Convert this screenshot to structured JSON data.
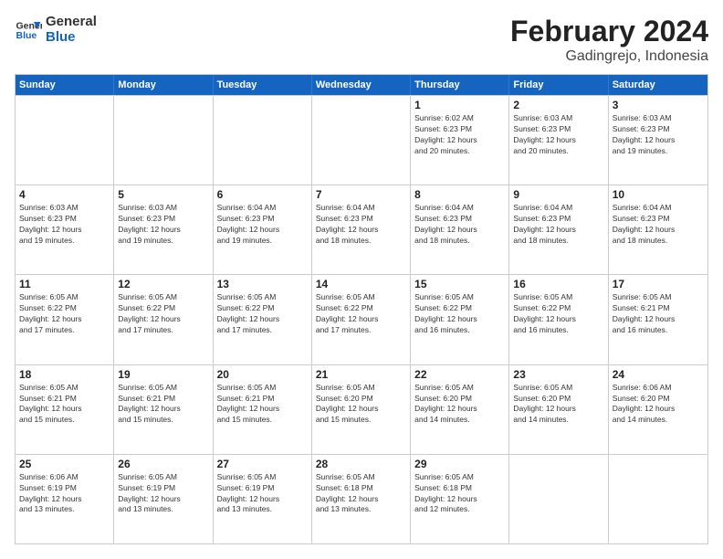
{
  "header": {
    "logo_line1": "General",
    "logo_line2": "Blue",
    "main_title": "February 2024",
    "subtitle": "Gadingrejo, Indonesia"
  },
  "calendar": {
    "days_of_week": [
      "Sunday",
      "Monday",
      "Tuesday",
      "Wednesday",
      "Thursday",
      "Friday",
      "Saturday"
    ],
    "rows": [
      [
        {
          "day": "",
          "info": ""
        },
        {
          "day": "",
          "info": ""
        },
        {
          "day": "",
          "info": ""
        },
        {
          "day": "",
          "info": ""
        },
        {
          "day": "1",
          "info": "Sunrise: 6:02 AM\nSunset: 6:23 PM\nDaylight: 12 hours\nand 20 minutes."
        },
        {
          "day": "2",
          "info": "Sunrise: 6:03 AM\nSunset: 6:23 PM\nDaylight: 12 hours\nand 20 minutes."
        },
        {
          "day": "3",
          "info": "Sunrise: 6:03 AM\nSunset: 6:23 PM\nDaylight: 12 hours\nand 19 minutes."
        }
      ],
      [
        {
          "day": "4",
          "info": "Sunrise: 6:03 AM\nSunset: 6:23 PM\nDaylight: 12 hours\nand 19 minutes."
        },
        {
          "day": "5",
          "info": "Sunrise: 6:03 AM\nSunset: 6:23 PM\nDaylight: 12 hours\nand 19 minutes."
        },
        {
          "day": "6",
          "info": "Sunrise: 6:04 AM\nSunset: 6:23 PM\nDaylight: 12 hours\nand 19 minutes."
        },
        {
          "day": "7",
          "info": "Sunrise: 6:04 AM\nSunset: 6:23 PM\nDaylight: 12 hours\nand 18 minutes."
        },
        {
          "day": "8",
          "info": "Sunrise: 6:04 AM\nSunset: 6:23 PM\nDaylight: 12 hours\nand 18 minutes."
        },
        {
          "day": "9",
          "info": "Sunrise: 6:04 AM\nSunset: 6:23 PM\nDaylight: 12 hours\nand 18 minutes."
        },
        {
          "day": "10",
          "info": "Sunrise: 6:04 AM\nSunset: 6:23 PM\nDaylight: 12 hours\nand 18 minutes."
        }
      ],
      [
        {
          "day": "11",
          "info": "Sunrise: 6:05 AM\nSunset: 6:22 PM\nDaylight: 12 hours\nand 17 minutes."
        },
        {
          "day": "12",
          "info": "Sunrise: 6:05 AM\nSunset: 6:22 PM\nDaylight: 12 hours\nand 17 minutes."
        },
        {
          "day": "13",
          "info": "Sunrise: 6:05 AM\nSunset: 6:22 PM\nDaylight: 12 hours\nand 17 minutes."
        },
        {
          "day": "14",
          "info": "Sunrise: 6:05 AM\nSunset: 6:22 PM\nDaylight: 12 hours\nand 17 minutes."
        },
        {
          "day": "15",
          "info": "Sunrise: 6:05 AM\nSunset: 6:22 PM\nDaylight: 12 hours\nand 16 minutes."
        },
        {
          "day": "16",
          "info": "Sunrise: 6:05 AM\nSunset: 6:22 PM\nDaylight: 12 hours\nand 16 minutes."
        },
        {
          "day": "17",
          "info": "Sunrise: 6:05 AM\nSunset: 6:21 PM\nDaylight: 12 hours\nand 16 minutes."
        }
      ],
      [
        {
          "day": "18",
          "info": "Sunrise: 6:05 AM\nSunset: 6:21 PM\nDaylight: 12 hours\nand 15 minutes."
        },
        {
          "day": "19",
          "info": "Sunrise: 6:05 AM\nSunset: 6:21 PM\nDaylight: 12 hours\nand 15 minutes."
        },
        {
          "day": "20",
          "info": "Sunrise: 6:05 AM\nSunset: 6:21 PM\nDaylight: 12 hours\nand 15 minutes."
        },
        {
          "day": "21",
          "info": "Sunrise: 6:05 AM\nSunset: 6:20 PM\nDaylight: 12 hours\nand 15 minutes."
        },
        {
          "day": "22",
          "info": "Sunrise: 6:05 AM\nSunset: 6:20 PM\nDaylight: 12 hours\nand 14 minutes."
        },
        {
          "day": "23",
          "info": "Sunrise: 6:05 AM\nSunset: 6:20 PM\nDaylight: 12 hours\nand 14 minutes."
        },
        {
          "day": "24",
          "info": "Sunrise: 6:06 AM\nSunset: 6:20 PM\nDaylight: 12 hours\nand 14 minutes."
        }
      ],
      [
        {
          "day": "25",
          "info": "Sunrise: 6:06 AM\nSunset: 6:19 PM\nDaylight: 12 hours\nand 13 minutes."
        },
        {
          "day": "26",
          "info": "Sunrise: 6:05 AM\nSunset: 6:19 PM\nDaylight: 12 hours\nand 13 minutes."
        },
        {
          "day": "27",
          "info": "Sunrise: 6:05 AM\nSunset: 6:19 PM\nDaylight: 12 hours\nand 13 minutes."
        },
        {
          "day": "28",
          "info": "Sunrise: 6:05 AM\nSunset: 6:18 PM\nDaylight: 12 hours\nand 13 minutes."
        },
        {
          "day": "29",
          "info": "Sunrise: 6:05 AM\nSunset: 6:18 PM\nDaylight: 12 hours\nand 12 minutes."
        },
        {
          "day": "",
          "info": ""
        },
        {
          "day": "",
          "info": ""
        }
      ]
    ]
  }
}
